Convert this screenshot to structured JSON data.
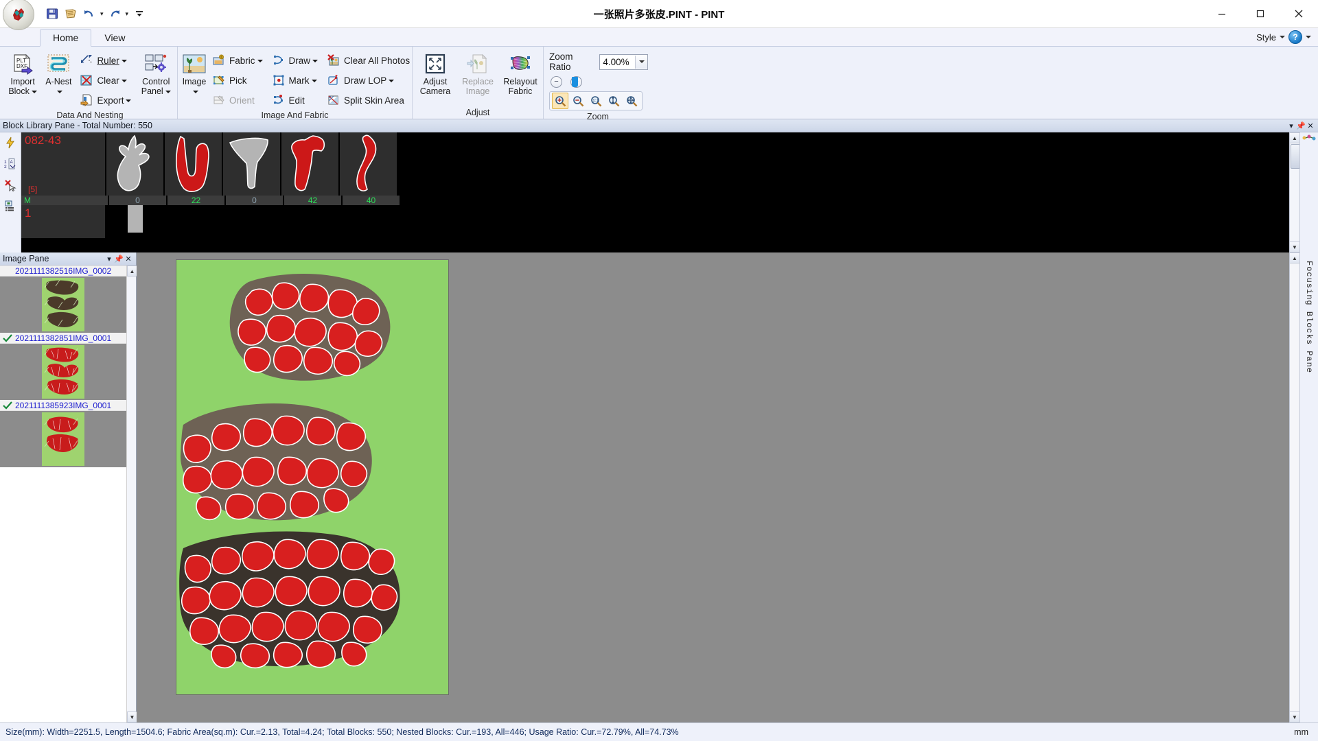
{
  "window": {
    "title": "一张照片多张皮.PINT - PINT",
    "minimize": "minimize-icon",
    "maximize": "maximize-icon",
    "close": "close-icon"
  },
  "quick_access": {
    "save": "save-icon",
    "print": "print-icon",
    "undo": "undo-icon",
    "redo": "redo-icon",
    "more": "more-icon"
  },
  "tabs": [
    {
      "label": "Home",
      "active": true
    },
    {
      "label": "View",
      "active": false
    }
  ],
  "tabs_right": {
    "style_label": "Style",
    "help_label": "?"
  },
  "ribbon": {
    "groups": [
      {
        "title": "Data And Nesting",
        "big_buttons": [
          {
            "label1": "Import",
            "label2": "Block",
            "icon": "import-block-icon",
            "dropdown": true,
            "disabled": false
          },
          {
            "label1": "A-Nest",
            "label2": "",
            "icon": "a-nest-icon",
            "dropdown": true,
            "disabled": false
          }
        ],
        "small_buttons": [
          {
            "label": "Ruler",
            "icon": "ruler-icon",
            "dropdown": true
          },
          {
            "label": "Clear",
            "icon": "clear-icon",
            "dropdown": true
          },
          {
            "label": "Export",
            "icon": "export-icon",
            "dropdown": true
          }
        ],
        "big_buttons_2": [
          {
            "label1": "Control",
            "label2": "Panel",
            "icon": "control-panel-icon",
            "dropdown": true,
            "disabled": false
          }
        ]
      },
      {
        "title": "Image And Fabric",
        "big_buttons": [
          {
            "label1": "Image",
            "label2": "",
            "icon": "image-icon",
            "dropdown": true,
            "disabled": false
          }
        ],
        "small_columns": [
          [
            {
              "label": "Fabric",
              "icon": "fabric-icon",
              "dropdown": true,
              "disabled": false
            },
            {
              "label": "Pick",
              "icon": "pick-icon",
              "dropdown": false,
              "disabled": false
            },
            {
              "label": "Orient",
              "icon": "orient-icon",
              "dropdown": false,
              "disabled": true
            }
          ],
          [
            {
              "label": "Draw",
              "icon": "draw-icon",
              "dropdown": true,
              "disabled": false
            },
            {
              "label": "Mark",
              "icon": "mark-icon",
              "dropdown": true,
              "disabled": false
            },
            {
              "label": "Edit",
              "icon": "edit-icon",
              "dropdown": false,
              "disabled": false
            }
          ],
          [
            {
              "label": "Clear All Photos",
              "icon": "clear-all-photos-icon",
              "dropdown": false,
              "disabled": false
            },
            {
              "label": "Draw LOP",
              "icon": "draw-lop-icon",
              "dropdown": true,
              "disabled": false
            },
            {
              "label": "Split Skin Area",
              "icon": "split-skin-area-icon",
              "dropdown": false,
              "disabled": false
            }
          ]
        ]
      },
      {
        "title": "Adjust",
        "big_buttons": [
          {
            "label1": "Adjust",
            "label2": "Camera",
            "icon": "adjust-camera-icon",
            "disabled": false
          },
          {
            "label1": "Replace",
            "label2": "Image",
            "icon": "replace-image-icon",
            "disabled": true
          },
          {
            "label1": "Relayout",
            "label2": "Fabric",
            "icon": "relayout-fabric-icon",
            "disabled": false
          }
        ]
      },
      {
        "title": "Zoom",
        "zoom_ratio_label": "Zoom Ratio",
        "zoom_ratio_value": "4.00%",
        "slider_minus": "minus-icon",
        "slider_plus": "plus-icon",
        "buttons": [
          {
            "icon": "zoom-in-icon",
            "active": true
          },
          {
            "icon": "zoom-out-icon",
            "active": false
          },
          {
            "icon": "zoom-actual-icon",
            "active": false
          },
          {
            "icon": "zoom-fit-height-icon",
            "active": false
          },
          {
            "icon": "zoom-fit-all-icon",
            "active": false
          }
        ]
      }
    ]
  },
  "block_library": {
    "title": "Block Library Pane - Total Number: 550",
    "header_buttons": [
      "chevron-down-icon",
      "pin-icon",
      "close-icon"
    ],
    "side_tools": [
      "lightning-icon",
      "sort-icon",
      "delete-icon",
      "list-icon"
    ],
    "row1": {
      "code": "082-43",
      "count": "[5]",
      "mark": "M",
      "cells": [
        {
          "shape": "hand-shape",
          "color": "#b4b4b4",
          "value": "0",
          "green": false
        },
        {
          "shape": "u-shape",
          "color": "#cc1818",
          "value": "22",
          "green": true
        },
        {
          "shape": "funnel-shape",
          "color": "#b4b4b4",
          "value": "0",
          "green": false
        },
        {
          "shape": "axe-shape",
          "color": "#cc1818",
          "value": "42",
          "green": true
        },
        {
          "shape": "curve-shape",
          "color": "#cc1818",
          "value": "40",
          "green": true
        }
      ]
    },
    "row2": {
      "code": "1"
    }
  },
  "image_pane": {
    "title": "Image Pane",
    "header_buttons": [
      "chevron-down-icon",
      "pin-icon",
      "close-icon"
    ],
    "items": [
      {
        "name": "2021111382516IMG_0002",
        "checked": false,
        "thumb": "dark-leather-thumb"
      },
      {
        "name": "2021111382851IMG_0001",
        "checked": true,
        "thumb": "red-nested-thumb"
      },
      {
        "name": "2021111385923IMG_0001",
        "checked": true,
        "thumb": "red-nested-thumb-2"
      }
    ]
  },
  "right_pane": {
    "label": "Focusing Blocks Pane",
    "icon": "focus-icon"
  },
  "status": {
    "text": "Size(mm): Width=2251.5, Length=1504.6; Fabric Area(sq.m): Cur.=2.13, Total=4.24; Total Blocks: 550; Nested Blocks: Cur.=193, All=446; Usage Ratio: Cur.=72.79%, All=74.73%",
    "unit": "mm"
  }
}
